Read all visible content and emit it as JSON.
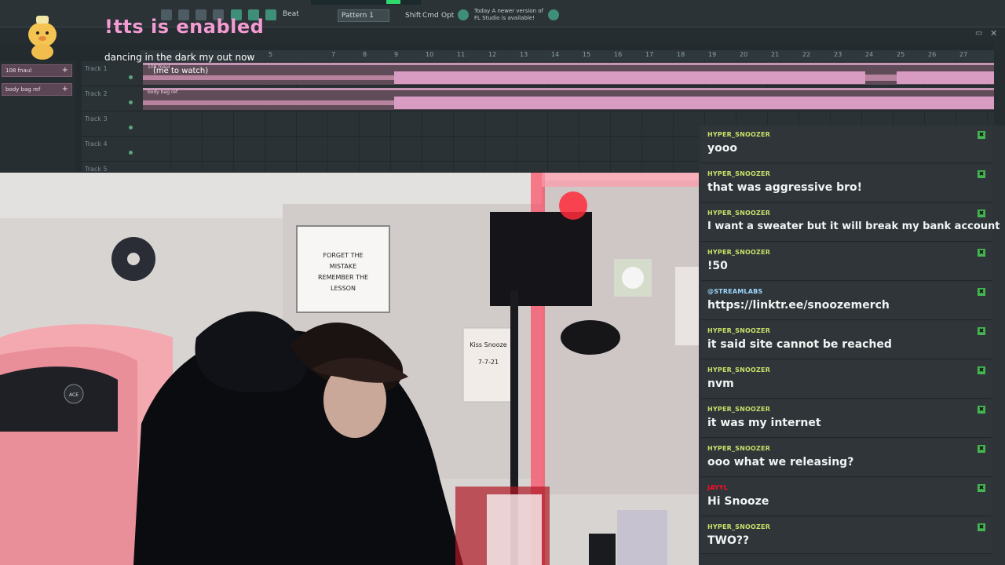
{
  "overlay": {
    "tts_title": "!tts is enabled",
    "now_playing": "dancing in the dark my out now",
    "watch_hint": "(me to watch)"
  },
  "fl_studio": {
    "pattern_label": "Pattern 1",
    "mode_beat": "Beat",
    "mode_shift": "Shift",
    "mode_cmd": "Cmd",
    "mode_opt": "Opt",
    "update_notice_line1": "Today  A newer version of",
    "update_notice_line2": "FL Studio is available!",
    "patterns": [
      {
        "label": "108 fnaul"
      },
      {
        "label": "body bag ref"
      }
    ],
    "tracks": [
      {
        "name": "Track 1",
        "clip": "108 fnaul"
      },
      {
        "name": "Track 2",
        "clip": "body bag ref"
      },
      {
        "name": "Track 3",
        "clip": ""
      },
      {
        "name": "Track 4",
        "clip": ""
      },
      {
        "name": "Track 5",
        "clip": ""
      }
    ],
    "ruler": [
      "5",
      "7",
      "8",
      "9",
      "10",
      "11",
      "12",
      "13",
      "14",
      "15",
      "16",
      "17",
      "18",
      "19",
      "20",
      "21",
      "22",
      "23",
      "24",
      "25",
      "26",
      "27"
    ]
  },
  "chat": {
    "messages": [
      {
        "user": "HYPER_SNOOZER",
        "text": "yooo",
        "style": "default"
      },
      {
        "user": "HYPER_SNOOZER",
        "text": "that was aggressive bro!",
        "style": "default"
      },
      {
        "user": "HYPER_SNOOZER",
        "text": "I want a sweater but it will break my bank account",
        "style": "default"
      },
      {
        "user": "HYPER_SNOOZER",
        "text": "!50",
        "style": "default"
      },
      {
        "user": "@STREAMLABS",
        "text": "https://linktr.ee/snoozemerch",
        "style": "streamlabs"
      },
      {
        "user": "HYPER_SNOOZER",
        "text": "it said site cannot be reached",
        "style": "default"
      },
      {
        "user": "HYPER_SNOOZER",
        "text": "nvm",
        "style": "default"
      },
      {
        "user": "HYPER_SNOOZER",
        "text": "it was my internet",
        "style": "default"
      },
      {
        "user": "HYPER_SNOOZER",
        "text": "ooo what we releasing?",
        "style": "default"
      },
      {
        "user": "JAYYL",
        "text": "Hi Snooze",
        "style": "red"
      },
      {
        "user": "HYPER_SNOOZER",
        "text": "TWO??",
        "style": "default"
      }
    ]
  },
  "webcam": {
    "poster_text": "FORGET THE MISTAKE REMEMBER THE LESSON",
    "card_text": "Kiss Snooze",
    "card_date": "7-7-21",
    "chair_label": "ACE"
  },
  "colors": {
    "accent_pink": "#f39bd2",
    "chat_username": "#c7e16b",
    "chat_background": "#2d3336"
  }
}
